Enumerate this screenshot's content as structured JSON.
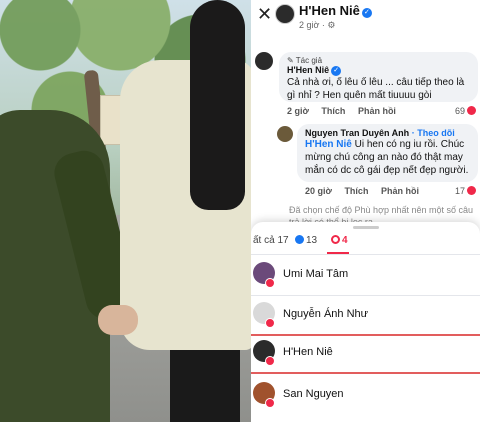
{
  "post": {
    "author": "H'Hen Niê",
    "time": "2 giờ · ⚙"
  },
  "comments": [
    {
      "author_tag": "✎ Tác giả",
      "author": "H'Hen Niê",
      "text": "Cả nhà ơi, ố lêu ố lêu ... câu tiếp theo là gì nhỉ ? Hen quên mất tiuuuu gòi",
      "time": "2 giờ",
      "like": "Thích",
      "reply": "Phản hồi",
      "reactions": "69"
    },
    {
      "author": "Nguyen Tran Duyên Anh",
      "follow": "· Theo dõi",
      "mention": "H'Hen Niê",
      "text": " Ui hen có ng iu rồi. Chúc mừng chú công an nào đó thật may mắn có dc cô gái đẹp nết đẹp người.",
      "time": "20 giờ",
      "like": "Thích",
      "reply": "Phản hồi",
      "reactions": "17"
    }
  ],
  "notice": "Đã chọn chế độ Phù hợp nhất nên một số câu trả lời có thể bị lọc ra.",
  "tabs": {
    "all": "ất cả 17",
    "like": "13",
    "love": "4"
  },
  "reactors": [
    {
      "name": "Umi Mai Tâm",
      "avatar_color": "#6b4a7a"
    },
    {
      "name": "Nguyễn Ánh Như",
      "avatar_color": "#d9d9d9"
    },
    {
      "name": "H'Hen Niê",
      "avatar_color": "#2b2b2b"
    },
    {
      "name": "San Nguyen",
      "avatar_color": "#a0522d"
    }
  ],
  "colors": {
    "facebook_blue": "#1877f2",
    "love_red": "#f02849",
    "highlight_border": "#e25d5d"
  }
}
